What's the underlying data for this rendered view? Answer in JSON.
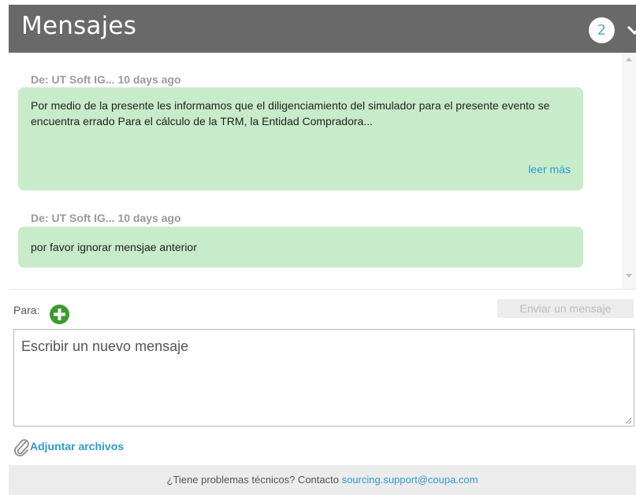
{
  "header": {
    "title": "Mensajes",
    "count": "2",
    "chevron_icon": "chevron-down-icon"
  },
  "messages": [
    {
      "meta": "De: UT Soft IG... 10 days ago",
      "text": "Por medio de la presente les informamos que el diligenciamiento del simulador para el presente evento se encuentra errado Para el cálculo de la TRM, la Entidad Compradora...",
      "read_more": "leer más"
    },
    {
      "meta": "De: UT Soft IG... 10 days ago",
      "text": "por favor ignorar mensjae anterior"
    }
  ],
  "compose": {
    "to_label": "Para:",
    "add_icon": "plus-circle-icon",
    "send_label": "Enviar un mensaje",
    "placeholder": "Escribir un nuevo mensaje",
    "attach_icon": "paperclip-icon",
    "attach_label": "Adjuntar archivos"
  },
  "footer": {
    "text": "¿Tiene problemas técnicos? Contacto ",
    "email": "sourcing.support@coupa.com"
  },
  "colors": {
    "header_bg": "#696969",
    "bubble_bg": "#c8ecca",
    "link": "#2e9ad6",
    "add_icon": "#3c9a2e"
  }
}
